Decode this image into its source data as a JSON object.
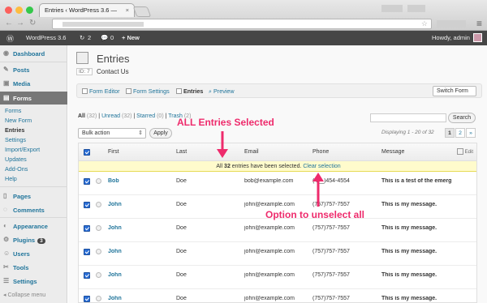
{
  "browser": {
    "tab_title": "Entries ‹ WordPress 3.6 —",
    "tab_close": "×"
  },
  "admin_bar": {
    "wp_logo": "wordpress-icon",
    "site_name": "WordPress 3.6",
    "updates_count": "2",
    "comments_count": "0",
    "new_label": "+ New",
    "greeting": "Howdy, admin"
  },
  "sidebar": {
    "items": [
      {
        "label": "Dashboard",
        "icon": "dashboard-icon"
      },
      {
        "label": "Posts",
        "icon": "posts-icon"
      },
      {
        "label": "Media",
        "icon": "media-icon"
      },
      {
        "label": "Forms",
        "icon": "forms-icon"
      },
      {
        "label": "Pages",
        "icon": "pages-icon"
      },
      {
        "label": "Comments",
        "icon": "comments-icon"
      },
      {
        "label": "Appearance",
        "icon": "appearance-icon"
      },
      {
        "label": "Plugins",
        "icon": "plugins-icon",
        "badge": "3"
      },
      {
        "label": "Users",
        "icon": "users-icon"
      },
      {
        "label": "Tools",
        "icon": "tools-icon"
      },
      {
        "label": "Settings",
        "icon": "settings-icon"
      }
    ],
    "forms_submenu": [
      "Forms",
      "New Form",
      "Entries",
      "Settings",
      "Import/Export",
      "Updates",
      "Add-Ons",
      "Help"
    ],
    "collapse_label": "Collapse menu"
  },
  "page": {
    "title": "Entries",
    "id_label": "ID: 7",
    "form_name": "Contact Us"
  },
  "form_toolbar": {
    "links": [
      "Form Editor",
      "Form Settings",
      "Entries",
      "Preview"
    ],
    "switch_form": "Switch Form"
  },
  "filters": {
    "all": "All",
    "all_count": "(32)",
    "unread": "Unread",
    "unread_count": "(32)",
    "starred": "Starred",
    "starred_count": "(0)",
    "trash": "Trash",
    "trash_count": "(2)"
  },
  "search": {
    "button": "Search",
    "placeholder": ""
  },
  "bulk": {
    "selected": "Bulk action",
    "apply": "Apply"
  },
  "pagination": {
    "displaying": "Displaying 1 - 20 of 32",
    "pages": [
      "1",
      "2"
    ],
    "next": "»"
  },
  "table": {
    "columns": [
      "First",
      "Last",
      "Email",
      "Phone",
      "Message"
    ],
    "edit_label": "Edit",
    "notice_prefix": "All ",
    "notice_count": "32",
    "notice_suffix": " entries have been selected. ",
    "notice_link": "Clear selection",
    "rows": [
      {
        "first": "Bob",
        "last": "Doe",
        "email": "bob@example.com",
        "phone": "(4__)454-4554",
        "message": "This is a test of the emerg"
      },
      {
        "first": "John",
        "last": "Doe",
        "email": "john@example.com",
        "phone": "(757)757-7557",
        "message": "This is my message."
      },
      {
        "first": "John",
        "last": "Doe",
        "email": "john@example.com",
        "phone": "(757)757-7557",
        "message": "This is my message."
      },
      {
        "first": "John",
        "last": "Doe",
        "email": "john@example.com",
        "phone": "(757)757-7557",
        "message": "This is my message."
      },
      {
        "first": "John",
        "last": "Doe",
        "email": "john@example.com",
        "phone": "(757)757-7557",
        "message": "This is my message."
      },
      {
        "first": "John",
        "last": "Doe",
        "email": "john@example.com",
        "phone": "(757)757-7557",
        "message": "This is my message."
      }
    ]
  },
  "annotations": {
    "all_selected": "ALL Entries Selected",
    "unselect": "Option to unselect all",
    "color": "#ee2b6c"
  }
}
